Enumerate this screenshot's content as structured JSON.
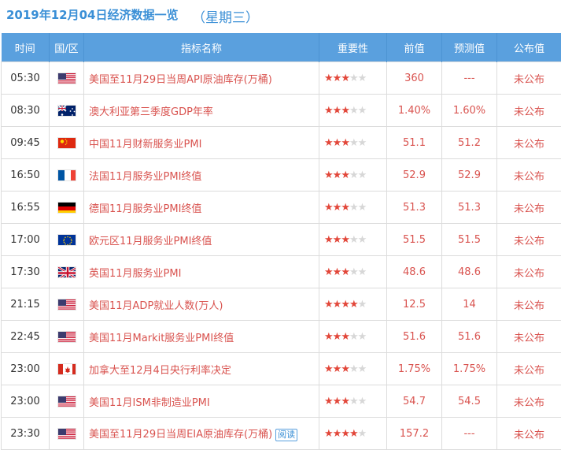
{
  "header": {
    "date": "2019年12月04日经济数据一览",
    "weekday": "（星期三）"
  },
  "columns": [
    "时间",
    "国/区",
    "指标名称",
    "重要性",
    "前值",
    "预测值",
    "公布值"
  ],
  "rows": [
    {
      "time": "05:30",
      "flag": "us",
      "name": "美国至11月29日当周API原油库存(万桶)",
      "stars": 3,
      "prev": "360",
      "forecast": "---",
      "actual": "未公布"
    },
    {
      "time": "08:30",
      "flag": "au",
      "name": "澳大利亚第三季度GDP年率",
      "stars": 3,
      "prev": "1.40%",
      "forecast": "1.60%",
      "actual": "未公布"
    },
    {
      "time": "09:45",
      "flag": "cn",
      "name": "中国11月财新服务业PMI",
      "stars": 3,
      "prev": "51.1",
      "forecast": "51.2",
      "actual": "未公布"
    },
    {
      "time": "16:50",
      "flag": "fr",
      "name": "法国11月服务业PMI终值",
      "stars": 3,
      "prev": "52.9",
      "forecast": "52.9",
      "actual": "未公布"
    },
    {
      "time": "16:55",
      "flag": "de",
      "name": "德国11月服务业PMI终值",
      "stars": 3,
      "prev": "51.3",
      "forecast": "51.3",
      "actual": "未公布"
    },
    {
      "time": "17:00",
      "flag": "eu",
      "name": "欧元区11月服务业PMI终值",
      "stars": 3,
      "prev": "51.5",
      "forecast": "51.5",
      "actual": "未公布"
    },
    {
      "time": "17:30",
      "flag": "uk",
      "name": "英国11月服务业PMI",
      "stars": 3,
      "prev": "48.6",
      "forecast": "48.6",
      "actual": "未公布"
    },
    {
      "time": "21:15",
      "flag": "us",
      "name": "美国11月ADP就业人数(万人)",
      "stars": 4,
      "prev": "12.5",
      "forecast": "14",
      "actual": "未公布"
    },
    {
      "time": "22:45",
      "flag": "us",
      "name": "美国11月Markit服务业PMI终值",
      "stars": 3,
      "prev": "51.6",
      "forecast": "51.6",
      "actual": "未公布"
    },
    {
      "time": "23:00",
      "flag": "ca",
      "name": "加拿大至12月4日央行利率决定",
      "stars": 3,
      "prev": "1.75%",
      "forecast": "1.75%",
      "actual": "未公布"
    },
    {
      "time": "23:00",
      "flag": "us",
      "name": "美国11月ISM非制造业PMI",
      "stars": 3,
      "prev": "54.7",
      "forecast": "54.5",
      "actual": "未公布"
    },
    {
      "time": "23:30",
      "flag": "us",
      "name": "美国至11月29日当周EIA原油库存(万桶)",
      "stars": 4,
      "prev": "157.2",
      "forecast": "---",
      "actual": "未公布",
      "read": "阅读"
    }
  ]
}
